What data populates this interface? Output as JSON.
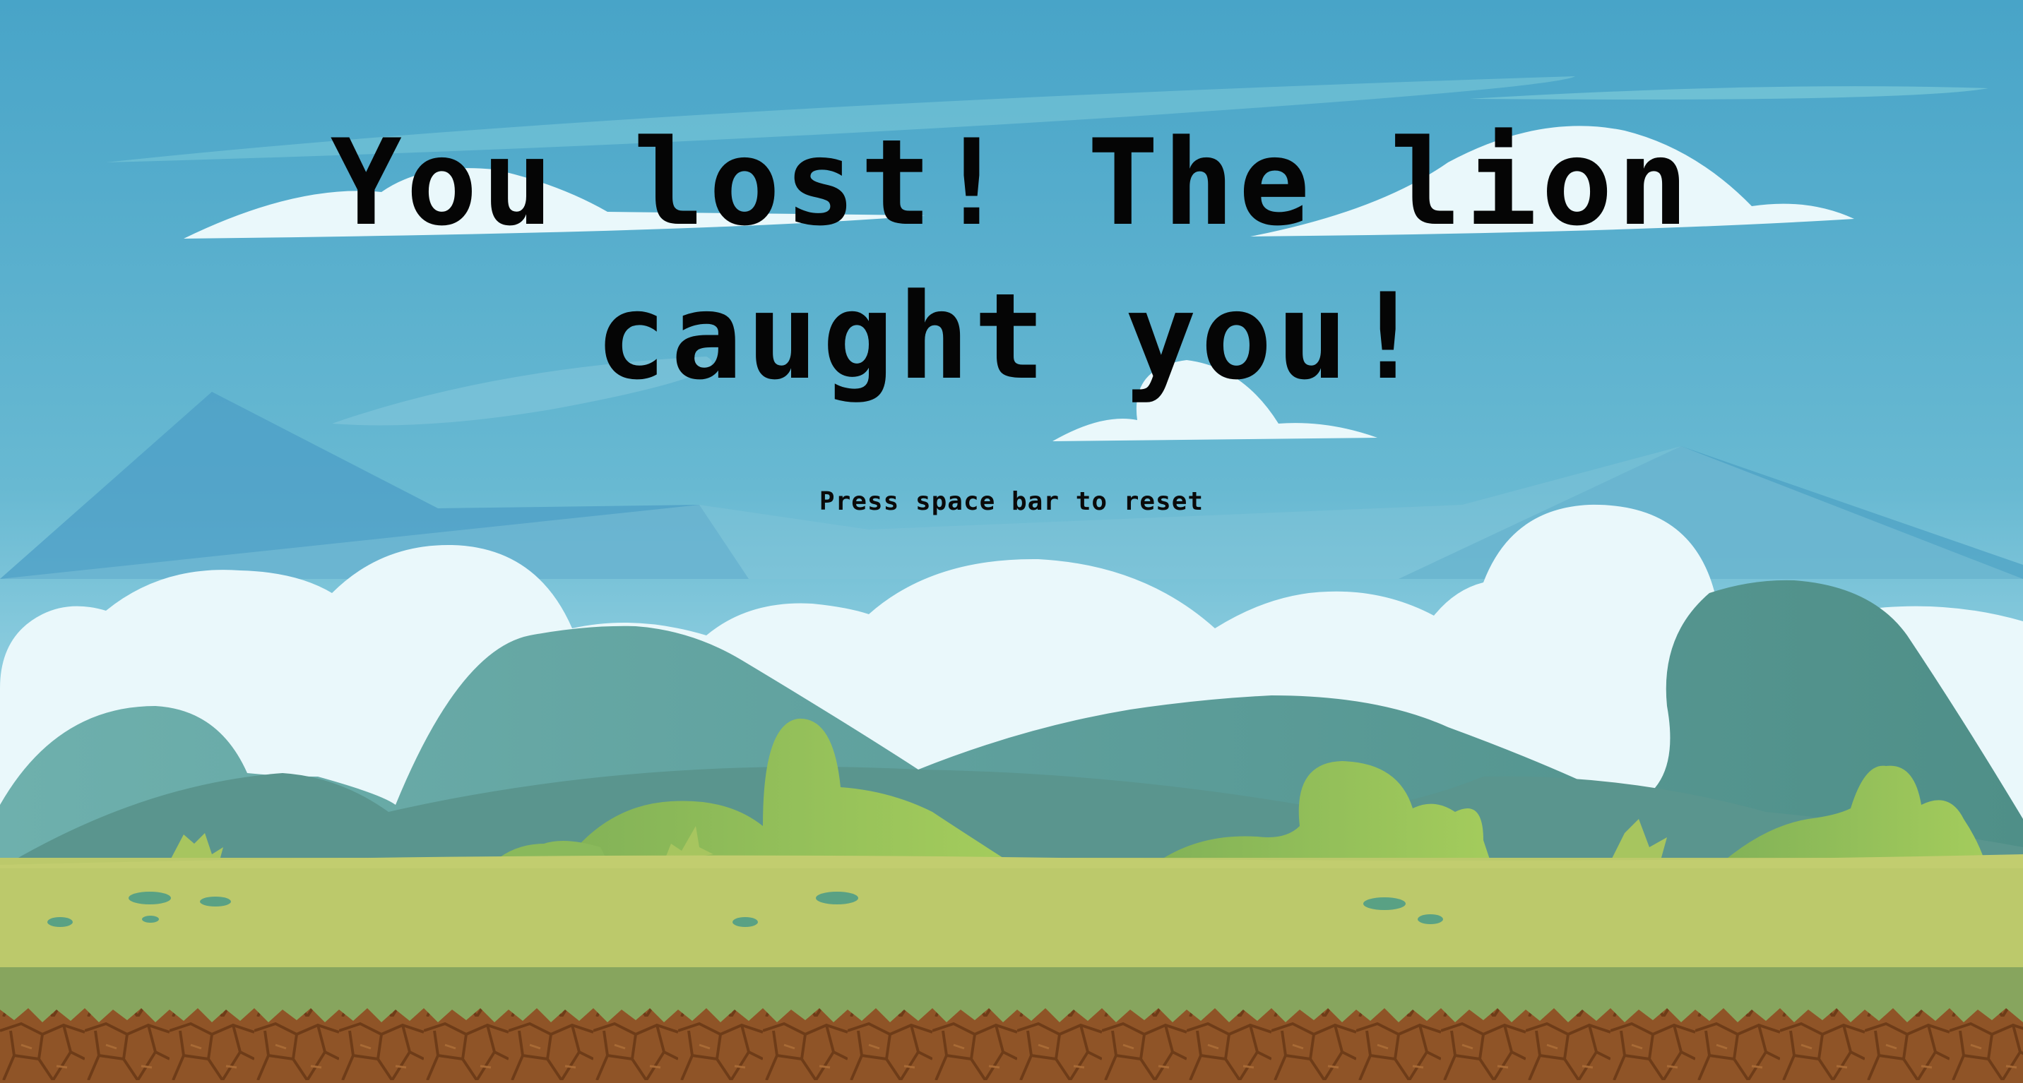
{
  "game": {
    "message_line1": "You lost! The lion",
    "message_line2": "caught you!",
    "hint": "Press space bar to reset"
  },
  "colors": {
    "sky_top": "#48a4c8",
    "sky_bottom": "#b8e4ee",
    "cloud": "#eaf8fb",
    "far_hill": "#5c9ea1",
    "near_hill": "#609f92",
    "bush": "#8db85a",
    "grass": "#bcc96b",
    "grass_dark": "#88a65e",
    "dirt": "#8e5426",
    "text": "#050505"
  }
}
